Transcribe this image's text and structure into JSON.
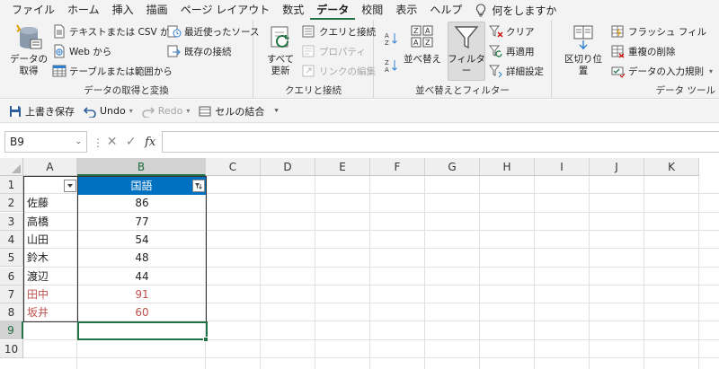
{
  "tabs": [
    "ファイル",
    "ホーム",
    "挿入",
    "描画",
    "ページ レイアウト",
    "数式",
    "データ",
    "校閲",
    "表示",
    "ヘルプ"
  ],
  "tell_me": "何をしますか",
  "ribbon": {
    "get_transform": {
      "get_data": "データの\n取得",
      "from_text_csv": "テキストまたは CSV から",
      "from_web": "Web から",
      "from_table": "テーブルまたは範囲から",
      "recent_sources": "最近使ったソース",
      "existing_connections": "既存の接続",
      "label": "データの取得と変換"
    },
    "queries": {
      "refresh_all": "すべて\n更新",
      "queries_connections": "クエリと接続",
      "properties": "プロパティ",
      "edit_links": "リンクの編集",
      "label": "クエリと接続"
    },
    "sort_filter": {
      "sort": "並べ替え",
      "filter": "フィルター",
      "clear": "クリア",
      "reapply": "再適用",
      "advanced": "詳細設定",
      "label": "並べ替えとフィルター"
    },
    "data_tools": {
      "text_to_columns": "区切り位置",
      "flash_fill": "フラッシュ フィル",
      "remove_duplicates": "重複の削除",
      "data_validation": "データの入力規則",
      "label": "データ ツール"
    }
  },
  "qat": {
    "save": "上書き保存",
    "undo": "Undo",
    "redo": "Redo",
    "merge_cells": "セルの結合"
  },
  "formula_bar": {
    "name_box": "B9",
    "fx": "fx",
    "formula": ""
  },
  "columns": [
    "A",
    "B",
    "C",
    "D",
    "E",
    "F",
    "G",
    "H",
    "I",
    "J",
    "K"
  ],
  "rows": [
    "1",
    "2",
    "3",
    "4",
    "5",
    "6",
    "7",
    "8",
    "9",
    "10"
  ],
  "table": {
    "header_b": "国語",
    "rows": [
      {
        "name": "佐藤",
        "score": "86",
        "red": false
      },
      {
        "name": "高橋",
        "score": "77",
        "red": false
      },
      {
        "name": "山田",
        "score": "54",
        "red": false
      },
      {
        "name": "鈴木",
        "score": "48",
        "red": false
      },
      {
        "name": "渡辺",
        "score": "44",
        "red": false
      },
      {
        "name": "田中",
        "score": "91",
        "red": true
      },
      {
        "name": "坂井",
        "score": "60",
        "red": true
      }
    ]
  },
  "colors": {
    "accent": "#217346",
    "table_header": "#0070c0",
    "filtered_text": "#c0504d"
  }
}
